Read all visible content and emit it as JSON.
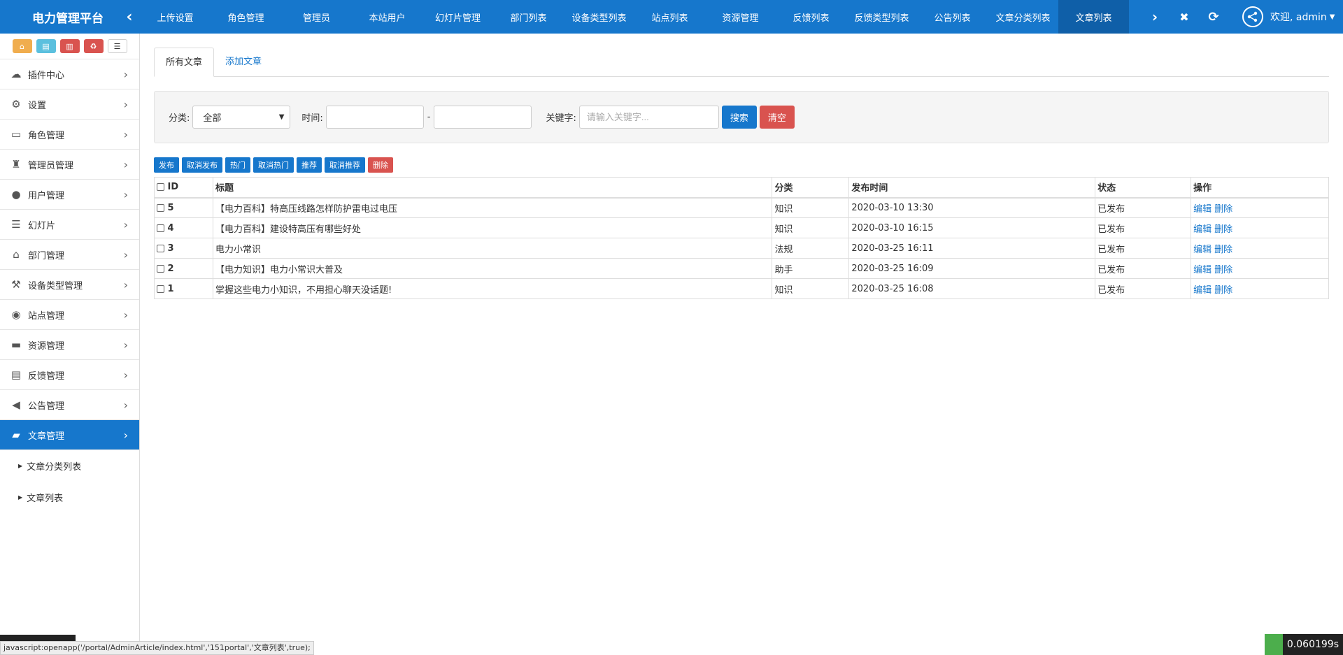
{
  "header": {
    "brand": "电力管理平台",
    "tabs": [
      "上传设置",
      "角色管理",
      "管理员",
      "本站用户",
      "幻灯片管理",
      "部门列表",
      "设备类型列表",
      "站点列表",
      "资源管理",
      "反馈列表",
      "反馈类型列表",
      "公告列表",
      "文章分类列表",
      "文章列表"
    ],
    "active_tab": 13,
    "user": "欢迎, admin"
  },
  "sidebar": {
    "items": [
      {
        "label": "插件中心",
        "icon": "cloud-icon"
      },
      {
        "label": "设置",
        "icon": "gear-icon"
      },
      {
        "label": "角色管理",
        "icon": "id-card-icon"
      },
      {
        "label": "管理员管理",
        "icon": "user-secret-icon"
      },
      {
        "label": "用户管理",
        "icon": "user-icon"
      },
      {
        "label": "幻灯片",
        "icon": "list-icon"
      },
      {
        "label": "部门管理",
        "icon": "bank-icon"
      },
      {
        "label": "设备类型管理",
        "icon": "hammer-icon"
      },
      {
        "label": "站点管理",
        "icon": "podcast-icon"
      },
      {
        "label": "资源管理",
        "icon": "briefcase-icon"
      },
      {
        "label": "反馈管理",
        "icon": "file-text-icon"
      },
      {
        "label": "公告管理",
        "icon": "bullhorn-icon"
      },
      {
        "label": "文章管理",
        "icon": "book-icon"
      }
    ],
    "active_index": 12,
    "submenu": [
      "文章分类列表",
      "文章列表"
    ]
  },
  "content_tabs": [
    "所有文章",
    "添加文章"
  ],
  "filter": {
    "category_label": "分类:",
    "category_value": "全部",
    "time_label": "时间:",
    "time_separator": "-",
    "keyword_label": "关键字:",
    "keyword_placeholder": "请输入关键字...",
    "search_btn": "搜索",
    "clear_btn": "清空"
  },
  "actions": [
    "发布",
    "取消发布",
    "热门",
    "取消热门",
    "推荐",
    "取消推荐",
    "删除"
  ],
  "table": {
    "columns": [
      "ID",
      "标题",
      "分类",
      "发布时间",
      "状态",
      "操作"
    ],
    "rows": [
      {
        "id": "5",
        "title": "【电力百科】特高压线路怎样防护雷电过电压",
        "category": "知识",
        "time": "2020-03-10 13:30",
        "status": "已发布"
      },
      {
        "id": "4",
        "title": "【电力百科】建设特高压有哪些好处",
        "category": "知识",
        "time": "2020-03-10 16:15",
        "status": "已发布"
      },
      {
        "id": "3",
        "title": "电力小常识",
        "category": "法规",
        "time": "2020-03-25 16:11",
        "status": "已发布"
      },
      {
        "id": "2",
        "title": "【电力知识】电力小常识大普及",
        "category": "助手",
        "time": "2020-03-25 16:09",
        "status": "已发布"
      },
      {
        "id": "1",
        "title": "掌握这些电力小知识，不用担心聊天没话题!",
        "category": "知识",
        "time": "2020-03-25 16:08",
        "status": "已发布"
      }
    ],
    "op_edit": "编辑",
    "op_delete": "删除"
  },
  "statusbar": "javascript:openapp('/portal/AdminArticle/index.html','151portal','文章列表',true);",
  "timer": "0.060199s"
}
